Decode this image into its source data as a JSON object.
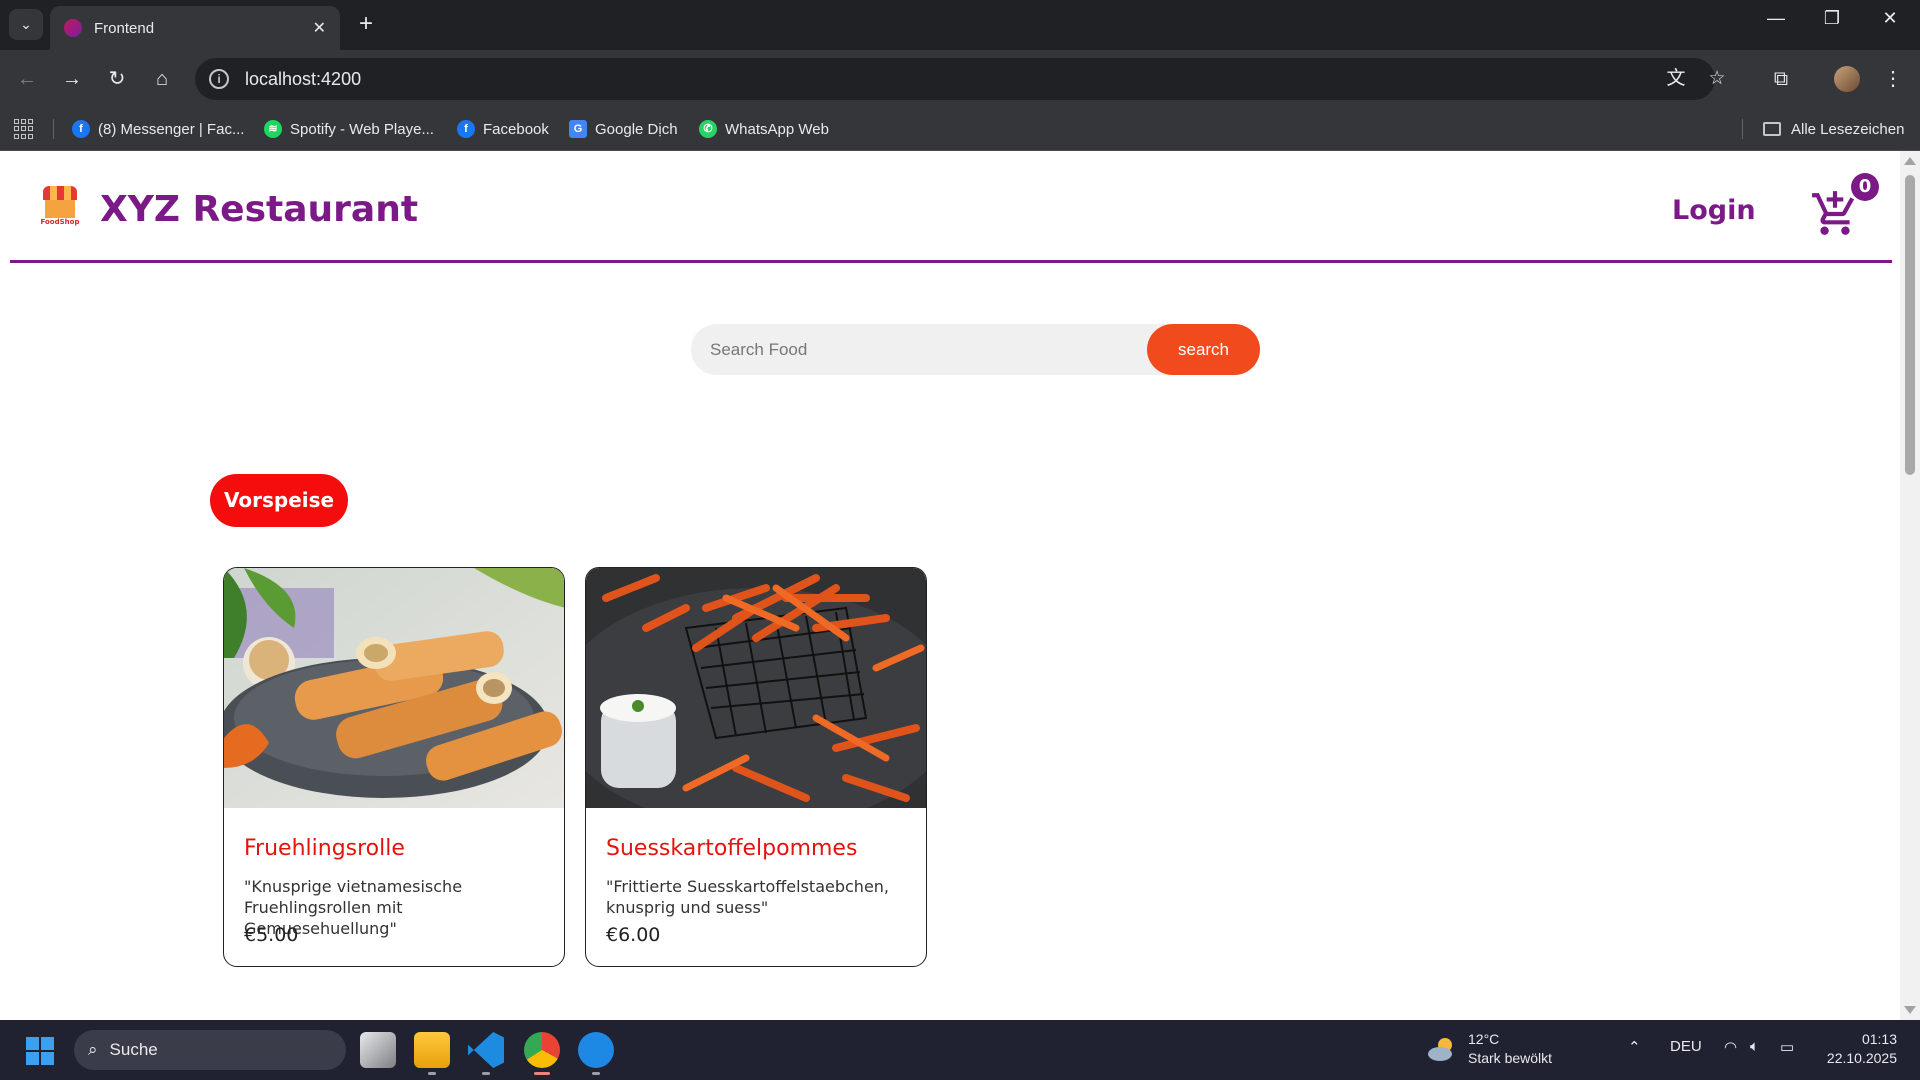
{
  "browser": {
    "tab_title": "Frontend",
    "url": "localhost:4200",
    "bookmarks": [
      {
        "label": "(8) Messenger | Fac...",
        "icon": "facebook-icon",
        "color": "#1877f2"
      },
      {
        "label": "Spotify - Web Playe...",
        "icon": "spotify-icon",
        "color": "#1ed760"
      },
      {
        "label": "Facebook",
        "icon": "facebook-icon",
        "color": "#1877f2"
      },
      {
        "label": "Google Dịch",
        "icon": "google-translate-icon",
        "color": "#4285f4"
      },
      {
        "label": "WhatsApp Web",
        "icon": "whatsapp-icon",
        "color": "#25d366"
      }
    ],
    "all_bookmarks": "Alle Lesezeichen"
  },
  "site": {
    "brand": "XYZ Restaurant",
    "logo_text": "FoodShop",
    "login": "Login",
    "cart_count": "0",
    "accent": "#7b1a86"
  },
  "search": {
    "placeholder": "Search Food",
    "button": "search"
  },
  "category": "Vorspeise",
  "foods": [
    {
      "name": "Fruehlingsrolle",
      "description": "\"Knusprige vietnamesische Fruehlingsrollen mit Gemuesehuellung\"",
      "price": "€5.00"
    },
    {
      "name": "Suesskartoffelpommes",
      "description": "\"Frittierte Suesskartoffelstaebchen, knusprig und suess\"",
      "price": "€6.00"
    }
  ],
  "taskbar": {
    "search": "Suche",
    "weather_temp": "12°C",
    "weather_desc": "Stark bewölkt",
    "language": "DEU",
    "time": "01:13",
    "date": "22.10.2025"
  }
}
